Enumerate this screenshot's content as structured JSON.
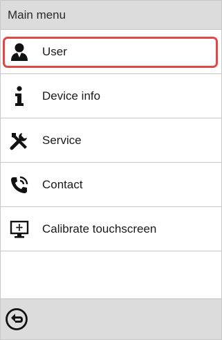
{
  "header": {
    "title": "Main menu"
  },
  "menu": {
    "items": [
      {
        "label": "User",
        "icon": "user-icon",
        "selected": true
      },
      {
        "label": "Device info",
        "icon": "info-icon"
      },
      {
        "label": "Service",
        "icon": "tools-icon"
      },
      {
        "label": "Contact",
        "icon": "phone-icon"
      },
      {
        "label": "Calibrate touchscreen",
        "icon": "monitor-icon"
      }
    ],
    "highlight_color": "#e04848"
  },
  "footer": {
    "back_icon": "back-arrow-icon"
  }
}
